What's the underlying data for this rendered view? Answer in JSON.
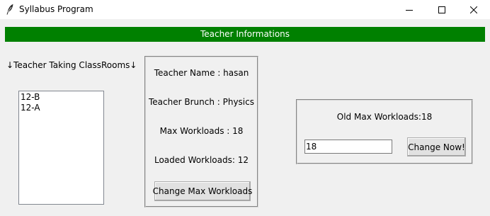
{
  "window": {
    "title": "Syllabus Program"
  },
  "header": {
    "title": "Teacher Informations"
  },
  "classrooms": {
    "label": "↓Teacher Taking ClassRooms↓",
    "items": [
      "12-B",
      "12-A"
    ]
  },
  "teacher": {
    "name_text": "Teacher Name : hasan",
    "branch_text": "Teacher Brunch : Physics",
    "max_workloads_text": "Max Workloads : 18",
    "loaded_workloads_text": "Loaded Workloads: 12",
    "change_button_label": "Change Max Workloads"
  },
  "update": {
    "old_max_text": "Old Max Workloads:18",
    "input_value": "18",
    "change_now_label": "Change Now!"
  },
  "colors": {
    "header_bg": "#008000",
    "header_text": "#ffffff",
    "window_bg": "#f0f0f0"
  },
  "icons": {
    "app": "feather-icon",
    "minimize": "minimize-icon",
    "maximize": "maximize-icon",
    "close": "close-icon"
  }
}
